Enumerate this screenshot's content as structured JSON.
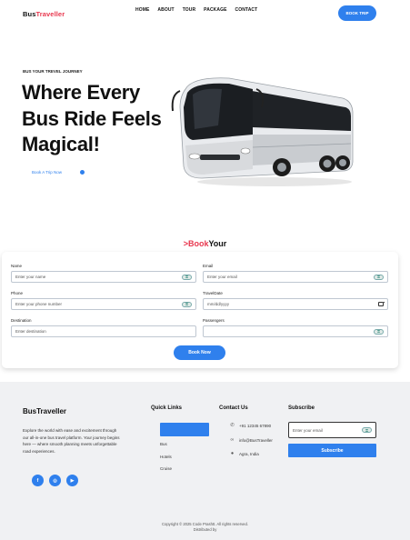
{
  "header": {
    "logo_part1": "Bus",
    "logo_part2": "Traveller",
    "nav": [
      "HOME",
      "ABOUT",
      "TOUR",
      "PACKAGE",
      "CONTACT"
    ],
    "cta_label": "BOOK TRIP"
  },
  "hero": {
    "tagline": "BUS YOUR TREVEL JOURNEY",
    "title_line1": "Where Every",
    "title_line2": "Bus Ride Feels",
    "title_line3": "Magical!",
    "cta_label": "Book A Trip Now"
  },
  "booking": {
    "heading_part1": ">Book",
    "heading_part2": "Your",
    "fields": {
      "name": {
        "label": "Name",
        "placeholder": "Enter your name"
      },
      "email": {
        "label": "Email",
        "placeholder": "Enter your email"
      },
      "phone": {
        "label": "Phone",
        "placeholder": "Enter your phone number"
      },
      "travel_date": {
        "label": "TravelDate",
        "placeholder": "mm/dd/yyyy"
      },
      "destination": {
        "label": "Destination",
        "placeholder": "Enter destination"
      },
      "passengers": {
        "label": "Passengers",
        "placeholder": ""
      }
    },
    "submit_label": "Book Now"
  },
  "footer": {
    "brand": "BusTraveller",
    "description": "Explore the world with ease and excitement through our all-in-one bus travel platform. Your journey begins here — where smooth planning meets unforgettable road experiences.",
    "social_icons": [
      "facebook-icon",
      "instagram-icon",
      "youtube-icon"
    ],
    "quick_links_heading": "Quick Links",
    "quick_links": [
      "Bus",
      "Hotels",
      "Cruise"
    ],
    "contact_heading": "Contact Us",
    "contact": {
      "phone": "+91 12345 67890",
      "email": "info@BusTraveller",
      "address": "Agra, India"
    },
    "subscribe_heading": "Subscribe",
    "subscribe_placeholder": "Enter your email",
    "subscribe_label": "Subscribe",
    "copyright": "Copyright © 2025 Code Prashtt. All rights reserved.",
    "distributed": "Distributed by"
  },
  "colors": {
    "accent": "#2f80ed",
    "brand_red": "#e8384f",
    "footer_bg": "#f0f1f3"
  }
}
